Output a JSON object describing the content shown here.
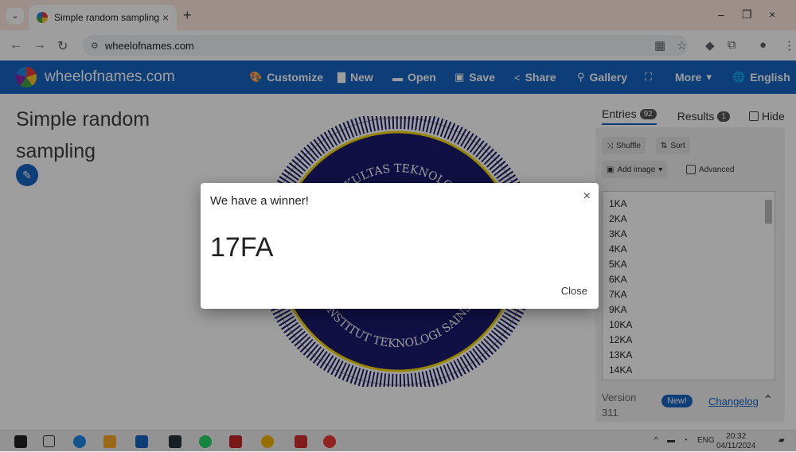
{
  "browser": {
    "tab_title": "Simple random sampling",
    "tab_close": "×",
    "new_tab": "+",
    "url": "wheelofnames.com",
    "win_minimize": "–",
    "win_restore": "❐",
    "win_close": "×"
  },
  "app": {
    "brand": "wheelofnames.com",
    "menu": [
      {
        "icon": "palette-icon",
        "glyph": "🎨",
        "label": "Customize"
      },
      {
        "icon": "file-icon",
        "glyph": "▇",
        "label": "New"
      },
      {
        "icon": "folder-open-icon",
        "glyph": "▬",
        "label": "Open"
      },
      {
        "icon": "save-icon",
        "glyph": "▣",
        "label": "Save"
      },
      {
        "icon": "share-icon",
        "glyph": "<",
        "label": "Share"
      },
      {
        "icon": "search-icon",
        "glyph": "⚲",
        "label": "Gallery"
      },
      {
        "icon": "fullscreen-icon",
        "glyph": "⛶",
        "label": ""
      },
      {
        "icon": "chevron-down-icon",
        "glyph": "▾",
        "label": "More"
      },
      {
        "icon": "globe-icon",
        "glyph": "🌐",
        "label": "English"
      }
    ]
  },
  "wheel": {
    "title": "Simple random sampling",
    "top_text": "FAKULTAS TEKNOLOGI",
    "bottom_text": "INSTITUT TEKNOLOGI SAINS"
  },
  "panel": {
    "tabs": [
      {
        "label": "Entries",
        "count": "92"
      },
      {
        "label": "Results",
        "count": "1"
      },
      {
        "label": "Hide",
        "count": ""
      }
    ],
    "shuffle_label": "Shuffle",
    "sort_label": "Sort",
    "add_image_label": "Add image",
    "advanced_label": "Advanced",
    "entries": [
      "1KA",
      "2KA",
      "3KA",
      "4KA",
      "5KA",
      "6KA",
      "7KA",
      "9KA",
      "10KA",
      "12KA",
      "13KA",
      "14KA"
    ],
    "version_label": "Version",
    "version_number": "311",
    "new_badge": "New!",
    "changelog_label": "Changelog"
  },
  "dialog": {
    "heading": "We have a winner!",
    "winner": "17FA",
    "close_label": "Close",
    "close_x": "×"
  },
  "taskbar": {
    "lang": "ENG",
    "time": "20:32",
    "date": "04/11/2024"
  },
  "colors": {
    "accent": "#1565c0",
    "wheel_navy": "#1a1a6e",
    "wheel_yellow": "#f5d800"
  }
}
